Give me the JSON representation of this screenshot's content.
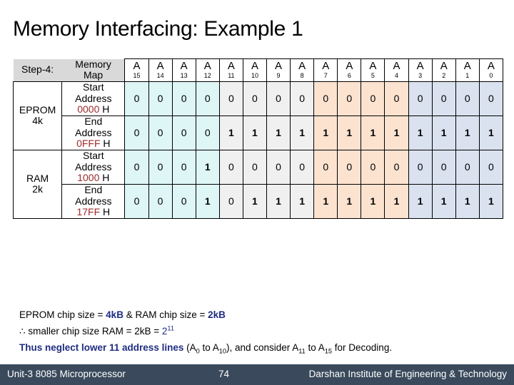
{
  "slide": {
    "title": "Memory Interfacing: Example 1"
  },
  "table": {
    "step_label": "Step-4:",
    "map_label_line1": "Memory",
    "map_label_line2": "Map",
    "address_prefix": "A",
    "address_indices": [
      "15",
      "14",
      "13",
      "12",
      "11",
      "10",
      "9",
      "8",
      "7",
      "6",
      "5",
      "4",
      "3",
      "2",
      "1",
      "0"
    ],
    "column_groups": [
      {
        "name": "cyan",
        "class": "g-cyan",
        "color": "#dff6f6",
        "bits": [
          "15",
          "14",
          "13",
          "12"
        ]
      },
      {
        "name": "gray",
        "class": "g-gray",
        "color": "#f0f0f0",
        "bits": [
          "11",
          "10",
          "9",
          "8"
        ]
      },
      {
        "name": "peach",
        "class": "g-peach",
        "color": "#fce3d0",
        "bits": [
          "7",
          "6",
          "5",
          "4"
        ]
      },
      {
        "name": "blue",
        "class": "g-blue",
        "color": "#dae2ef",
        "bits": [
          "3",
          "2",
          "1",
          "0"
        ]
      }
    ],
    "chips": [
      {
        "name": "EPROM",
        "size": "4k"
      },
      {
        "name": "RAM",
        "size": "2k"
      }
    ],
    "rows": [
      {
        "chip": "EPROM",
        "kind_line1": "Start",
        "kind_line2": "Address",
        "hex": "0000",
        "hex_suffix": "H",
        "bits": [
          "0",
          "0",
          "0",
          "0",
          "0",
          "0",
          "0",
          "0",
          "0",
          "0",
          "0",
          "0",
          "0",
          "0",
          "0",
          "0"
        ]
      },
      {
        "chip": "EPROM",
        "kind_line1": "End",
        "kind_line2": "Address",
        "hex": "0FFF",
        "hex_suffix": "H",
        "bits": [
          "0",
          "0",
          "0",
          "0",
          "1",
          "1",
          "1",
          "1",
          "1",
          "1",
          "1",
          "1",
          "1",
          "1",
          "1",
          "1"
        ]
      },
      {
        "chip": "RAM",
        "kind_line1": "Start",
        "kind_line2": "Address",
        "hex": "1000",
        "hex_suffix": "H",
        "bits": [
          "0",
          "0",
          "0",
          "1",
          "0",
          "0",
          "0",
          "0",
          "0",
          "0",
          "0",
          "0",
          "0",
          "0",
          "0",
          "0"
        ]
      },
      {
        "chip": "RAM",
        "kind_line1": "End",
        "kind_line2": "Address",
        "hex": "17FF",
        "hex_suffix": "H",
        "bits": [
          "0",
          "0",
          "0",
          "1",
          "0",
          "1",
          "1",
          "1",
          "1",
          "1",
          "1",
          "1",
          "1",
          "1",
          "1",
          "1"
        ]
      }
    ]
  },
  "notes": {
    "line1_a": "EPROM chip size = ",
    "line1_b": "4kB",
    "line1_c": " & RAM chip size = ",
    "line1_d": "2kB",
    "line2_a": "∴ smaller chip size RAM = 2kB = ",
    "line2_b": "2",
    "line2_sup": "11",
    "line3_a": "Thus neglect lower 11 address lines",
    "line3_b": " (A",
    "line3_sub1": "0",
    "line3_c": " to A",
    "line3_sub2": "10",
    "line3_d": "), and consider A",
    "line3_sub3": "11",
    "line3_e": " to A",
    "line3_sub4": "15",
    "line3_f": " for Decoding."
  },
  "footer": {
    "left": "Unit-3 8085 Microprocessor",
    "page": "74",
    "right": "Darshan Institute of Engineering & Technology",
    "background": "#3a4a5c"
  },
  "colors": {
    "zero": "#c0392b",
    "one": "#1f2d80",
    "hex": "#9e2a2b",
    "header_bg": "#d9d9d9",
    "accent_blue": "#1f2d80"
  }
}
